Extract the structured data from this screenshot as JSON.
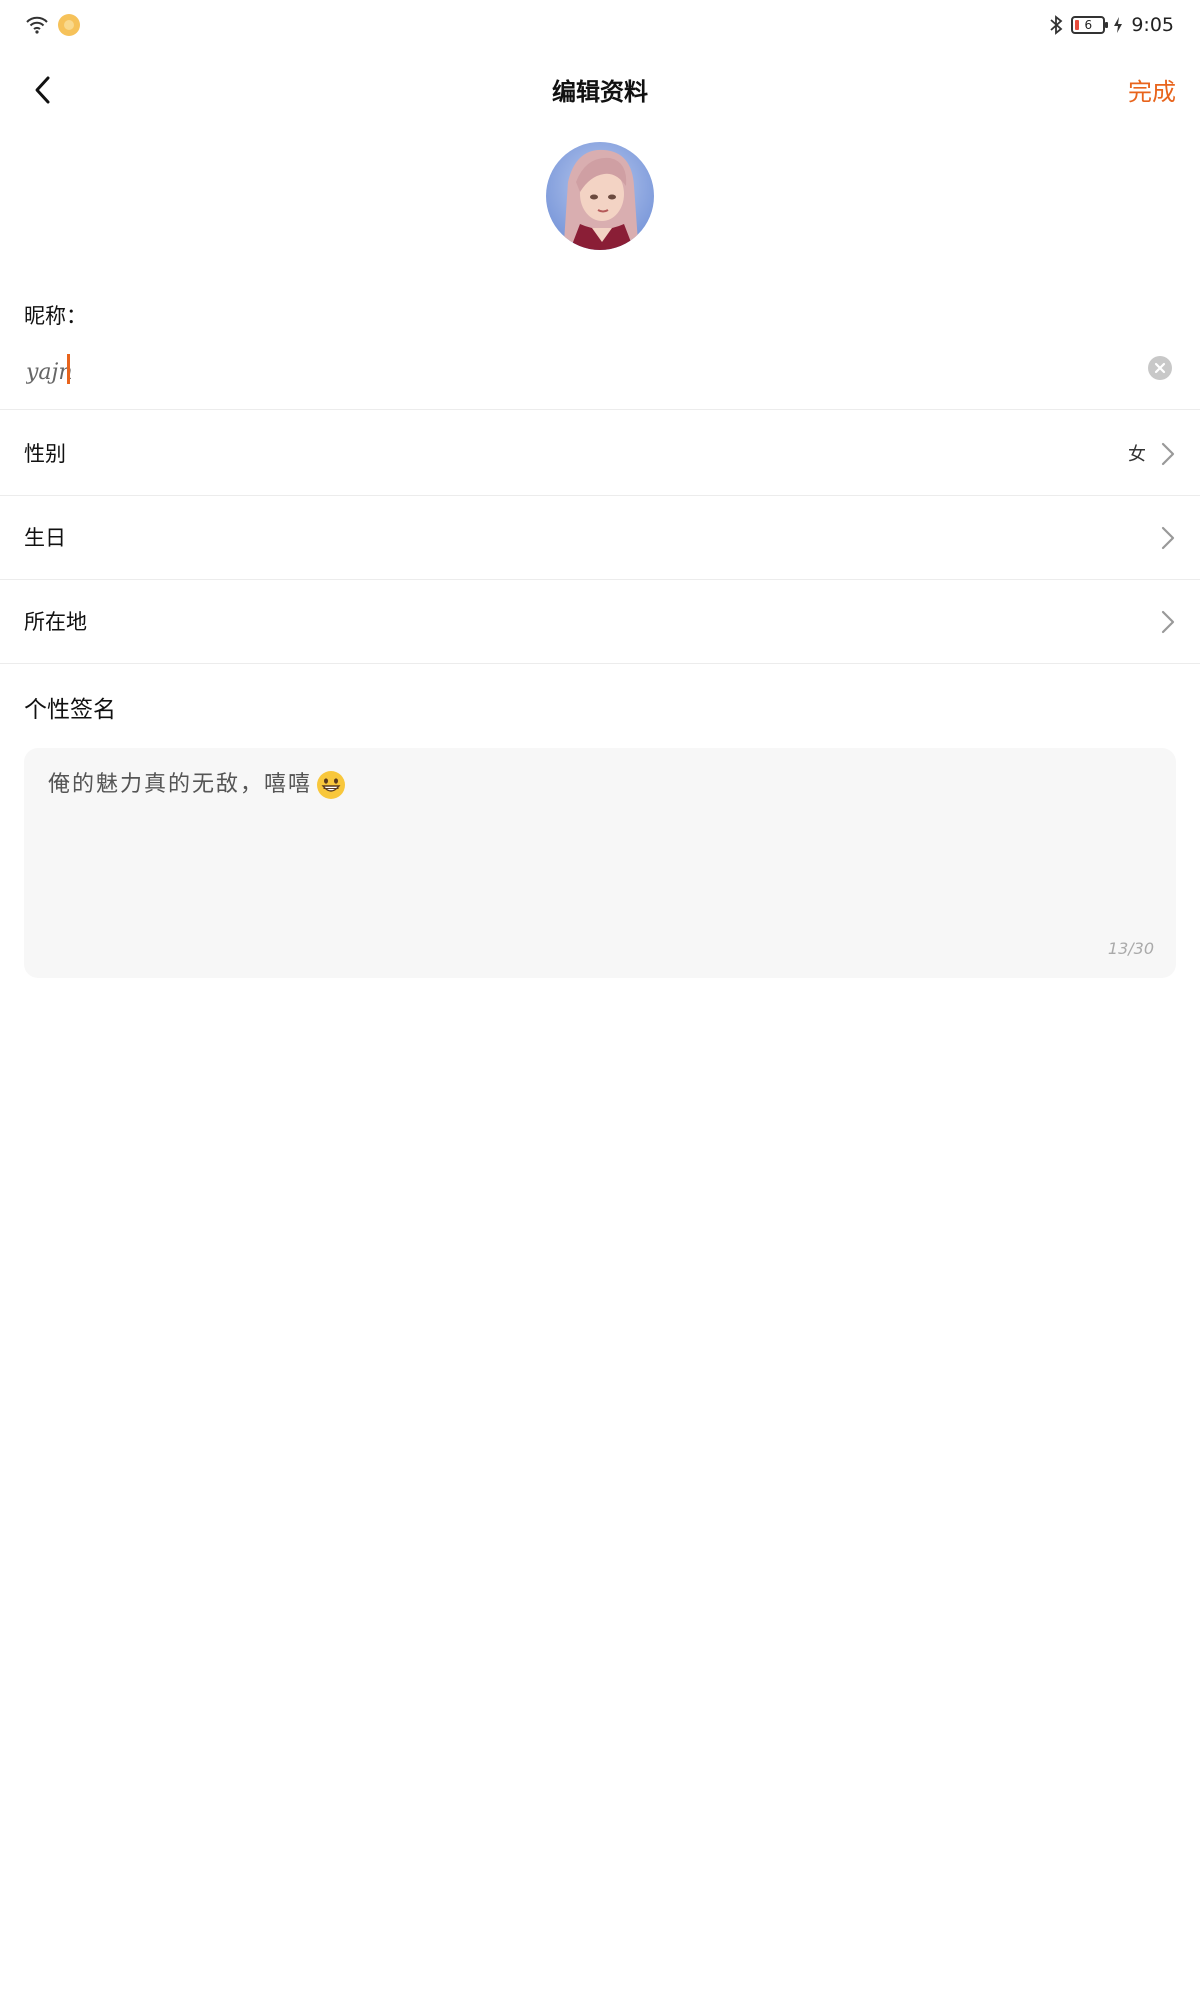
{
  "status_bar": {
    "time": "9:05",
    "battery": "6"
  },
  "nav": {
    "title": "编辑资料",
    "done_label": "完成"
  },
  "nickname": {
    "label": "昵称：",
    "value": "yajn"
  },
  "rows": [
    {
      "label": "性别",
      "value": "女"
    },
    {
      "label": "生日",
      "value": ""
    },
    {
      "label": "所在地",
      "value": ""
    }
  ],
  "bio": {
    "label": "个性签名",
    "text": "俺的魅力真的无敌，嘻嘻",
    "emoji": "grinning-face-icon",
    "counter": "13/30"
  },
  "colors": {
    "accent": "#e8641c",
    "input_bg": "#f7f7f7",
    "divider": "#ececec"
  }
}
